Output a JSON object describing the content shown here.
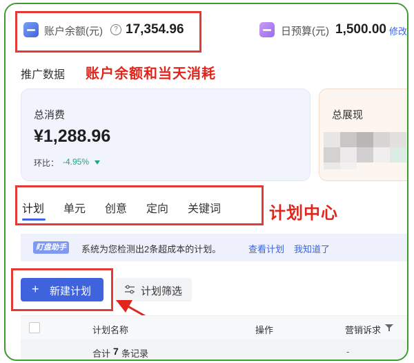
{
  "account": {
    "balance_label": "账户余额(元)",
    "help_symbol": "?",
    "balance_value": "17,354.96",
    "budget_label": "日预算(元)",
    "budget_value": "1,500.00",
    "edit_link": "修改"
  },
  "section": {
    "title": "推广数据",
    "annotation_balance": "账户余额和当天消耗",
    "annotation_plan": "计划中心"
  },
  "cards": {
    "total_spend_label": "总消费",
    "total_spend_value": "¥1,288.96",
    "mom_label": "环比：",
    "mom_value": "-4.95%",
    "impressions_label": "总展现"
  },
  "tabs": [
    "计划",
    "单元",
    "创意",
    "定向",
    "关键词"
  ],
  "banner": {
    "badge": "盯盘助手",
    "message": "系统为您检测出2条超成本的计划。",
    "view_link": "查看计划",
    "dismiss_link": "我知道了"
  },
  "toolbar": {
    "new_plan": "新建计划",
    "filter": "计划筛选"
  },
  "table": {
    "headers": [
      "计划名称",
      "操作",
      "营销诉求"
    ],
    "summary_prefix": "合计",
    "summary_count": "7",
    "summary_suffix": "条记录",
    "summary_dash": "-"
  },
  "colors": {
    "accent": "#3e63dd",
    "annotation": "#e0261c",
    "frame": "#3c9a2e",
    "positive_change": "#1fa67a"
  }
}
